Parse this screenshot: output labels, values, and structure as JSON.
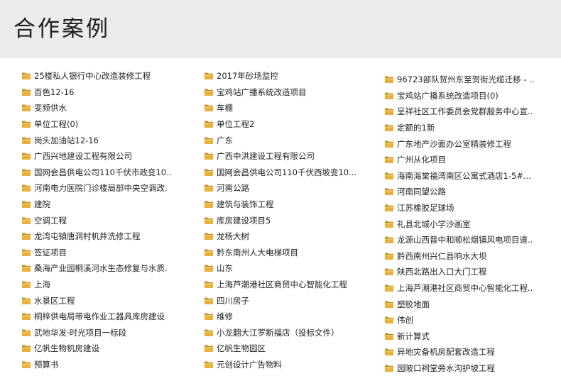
{
  "header": {
    "title": "合作案例"
  },
  "icon": "folder-icon",
  "columns": [
    {
      "items": [
        "25楼私人银行中心改造装修工程",
        "百色12-16",
        "变频供水",
        "单位工程(0)",
        "岗头加油站12-16",
        "广西兴地建设工程有限公司",
        "国网会昌供电公司110千伏市政变10..",
        "河南电力医院门诊楼局部中央空调改.",
        "建院",
        "空调工程",
        "龙湾屯镇唐洞村机井洗修工程",
        "签证项目",
        "桑海产业园桐溪河水生态修复与水质.",
        "上海",
        "水景区工程",
        "桐梓供电局带电作业工器具库房建设",
        "武地华发·时光项目一标段",
        "亿帆生物机房建设",
        "预算书"
      ]
    },
    {
      "items": [
        "2017年砂场监控",
        "宝鸡站广播系统改造项目",
        "车棚",
        "单位工程2",
        "广东",
        "广西中洪建设工程有限公司",
        "国网会昌供电公司110千伏西坡变10...",
        "河南公路",
        "建筑与装饰工程",
        "库房建设项目5",
        "龙杨大树",
        "黔东南州人大电梯项目",
        "山东",
        "上海芦潮港社区商贸中心智能化工程",
        "四川房子",
        "维修",
        "小龙翻大江罗斯福店（投标文件）",
        "亿帆生物园区",
        "元创设计广告物料"
      ]
    },
    {
      "items": [
        "96723部队贺州东至贺街光缆迁移 - ..",
        "宝鸡站广播系统改造项目(0)",
        "呈祥社区工作委员会党群服务中心宣..",
        "定额的1新",
        "广东地产沙面办公室精装修工程",
        "广州从化项目",
        "海南海棠福湾南区公寓式酒店1-5#...",
        "河南同望公路",
        "江苏橡胶足球场",
        "礼县北城小学沙画室",
        "龙源山西晋中和顺松烟镇风电项目道..",
        "黔西南州兴仁县响水大坝",
        "陕西北路出入口大门工程",
        "上海芦潮港社区商贸中心智能化工程..",
        "塑胶地面",
        "伟创",
        "新计算式",
        "异地灾备机房配套改造工程",
        "园陂口祠堂旁水沟护坡工程"
      ]
    }
  ],
  "colors": {
    "header_bg": "#ebebeb",
    "folder_body": "#e8b23a",
    "folder_tab": "#c98f1e"
  }
}
